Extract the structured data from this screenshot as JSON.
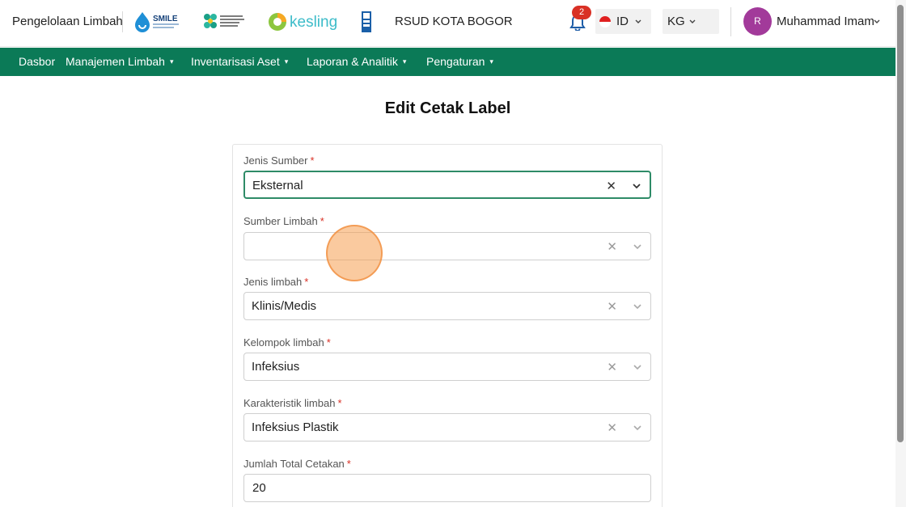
{
  "header": {
    "brand": "Pengelolaan Limbah",
    "logo_smile": "SMILE",
    "logo_kesling": "kesling",
    "hospital": "RSUD KOTA BOGOR",
    "notification_count": "2",
    "language": "ID",
    "unit": "KG",
    "avatar_initial": "R",
    "user_name": "Muhammad Imam"
  },
  "nav": {
    "items": [
      {
        "label": "Dasbor"
      },
      {
        "label": "Manajemen Limbah"
      },
      {
        "label": "Inventarisasi Aset"
      },
      {
        "label": "Laporan & Analitik"
      },
      {
        "label": "Pengaturan"
      }
    ],
    "color": "#0b7a57"
  },
  "page": {
    "title": "Edit Cetak Label"
  },
  "form": {
    "jenis_sumber": {
      "label": "Jenis Sumber",
      "required": "*",
      "value": "Eksternal"
    },
    "sumber_limbah": {
      "label": "Sumber Limbah",
      "required": "*",
      "value": ""
    },
    "jenis_limbah": {
      "label": "Jenis limbah",
      "required": "*",
      "value": "Klinis/Medis"
    },
    "kelompok_limbah": {
      "label": "Kelompok limbah",
      "required": "*",
      "value": "Infeksius"
    },
    "karakteristik_limbah": {
      "label": "Karakteristik limbah",
      "required": "*",
      "value": "Infeksius Plastik"
    },
    "jumlah_total_cetakan": {
      "label": "Jumlah Total Cetakan",
      "required": "*",
      "value": "20"
    }
  },
  "icons": {
    "clear": "✕",
    "nav_caret": "⌄"
  }
}
